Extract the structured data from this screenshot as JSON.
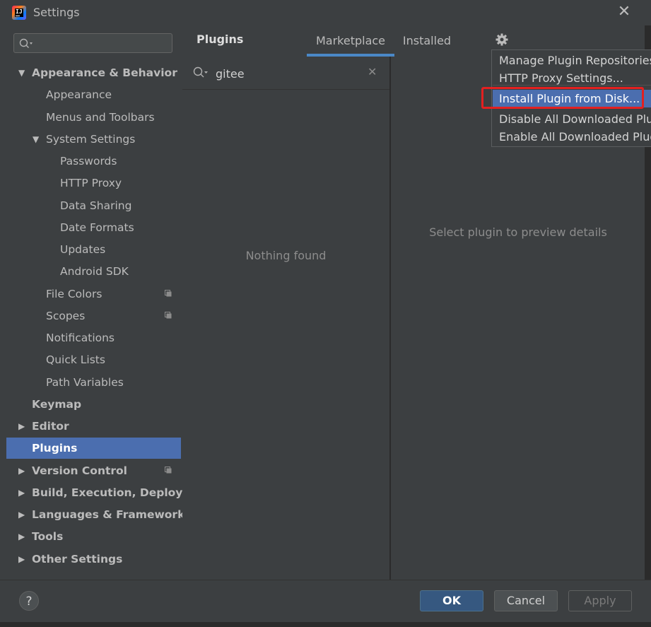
{
  "window": {
    "title": "Settings",
    "close_glyph": "✕"
  },
  "icons": {
    "app": "jetbrains-logo-icon",
    "search": "search-icon",
    "gear": "gear-icon",
    "clear": "close-icon",
    "help": "help-icon",
    "project": "project-scope-icon"
  },
  "colors": {
    "selection": "#4b6eaf",
    "ok": "#365880",
    "highlight_box": "#e32020",
    "tab_underline": "#4a88c7"
  },
  "sidebar": {
    "search_placeholder": "",
    "items": [
      {
        "label": "Appearance & Behavior",
        "level": 0,
        "bold": true,
        "arrow": "▼"
      },
      {
        "label": "Appearance",
        "level": 1
      },
      {
        "label": "Menus and Toolbars",
        "level": 1
      },
      {
        "label": "System Settings",
        "level": 1,
        "arrow": "▼"
      },
      {
        "label": "Passwords",
        "level": 2
      },
      {
        "label": "HTTP Proxy",
        "level": 2
      },
      {
        "label": "Data Sharing",
        "level": 2
      },
      {
        "label": "Date Formats",
        "level": 2
      },
      {
        "label": "Updates",
        "level": 2
      },
      {
        "label": "Android SDK",
        "level": 2
      },
      {
        "label": "File Colors",
        "level": 1,
        "project_icon": true
      },
      {
        "label": "Scopes",
        "level": 1,
        "project_icon": true
      },
      {
        "label": "Notifications",
        "level": 1
      },
      {
        "label": "Quick Lists",
        "level": 1
      },
      {
        "label": "Path Variables",
        "level": 1
      },
      {
        "label": "Keymap",
        "level": 0,
        "bold": true
      },
      {
        "label": "Editor",
        "level": 0,
        "bold": true,
        "arrow": "▶"
      },
      {
        "label": "Plugins",
        "level": 0,
        "bold": true,
        "selected": true
      },
      {
        "label": "Version Control",
        "level": 0,
        "bold": true,
        "arrow": "▶",
        "project_icon": true
      },
      {
        "label": "Build, Execution, Deploym",
        "level": 0,
        "bold": true,
        "arrow": "▶"
      },
      {
        "label": "Languages & Frameworks",
        "level": 0,
        "bold": true,
        "arrow": "▶"
      },
      {
        "label": "Tools",
        "level": 0,
        "bold": true,
        "arrow": "▶"
      },
      {
        "label": "Other Settings",
        "level": 0,
        "bold": true,
        "arrow": "▶"
      }
    ]
  },
  "header": {
    "title": "Plugins",
    "tabs": [
      {
        "label": "Marketplace",
        "active": true
      },
      {
        "label": "Installed",
        "active": false
      }
    ]
  },
  "plugin_list": {
    "search_value": "gitee",
    "empty_text": "Nothing found"
  },
  "detail": {
    "placeholder": "Select plugin to preview details"
  },
  "gear_menu": {
    "items": [
      {
        "label": "Manage Plugin Repositories..."
      },
      {
        "label": "HTTP Proxy Settings..."
      },
      {
        "label": "Install Plugin from Disk...",
        "highlighted": true
      },
      {
        "label": "Disable All Downloaded Plugins"
      },
      {
        "label": "Enable All Downloaded Plugins"
      }
    ]
  },
  "footer": {
    "help": "?",
    "ok": "OK",
    "cancel": "Cancel",
    "apply": "Apply"
  }
}
